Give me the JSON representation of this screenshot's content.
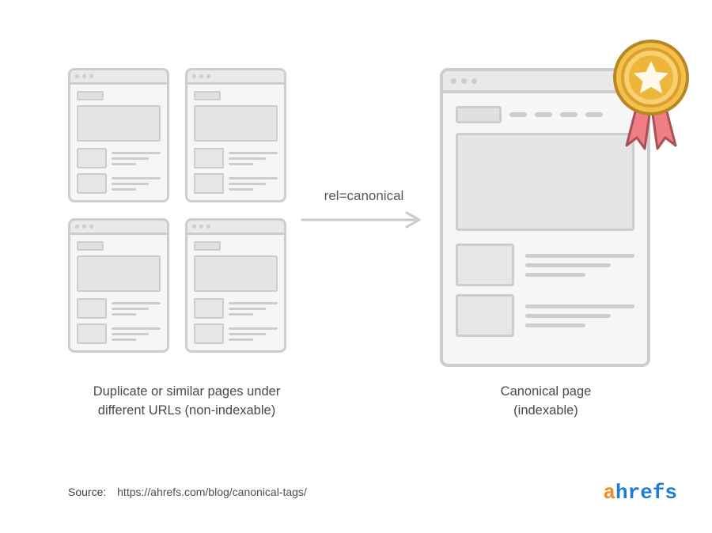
{
  "arrow": {
    "label": "rel=canonical"
  },
  "captions": {
    "left_line1": "Duplicate or similar pages under",
    "left_line2": "different URLs (non-indexable)",
    "right_line1": "Canonical page",
    "right_line2": "(indexable)"
  },
  "source": {
    "label": "Source:",
    "url": "https://ahrefs.com/blog/canonical-tags/"
  },
  "logo": {
    "part1": "a",
    "part2": "hrefs"
  },
  "colors": {
    "wire": "#cdcdcd",
    "fill": "#e4e4e4",
    "badge_gold": "#f3c049",
    "badge_gold_dark": "#d9a02d",
    "ribbon": "#ef7f84",
    "ribbon_dark": "#d5666b"
  }
}
